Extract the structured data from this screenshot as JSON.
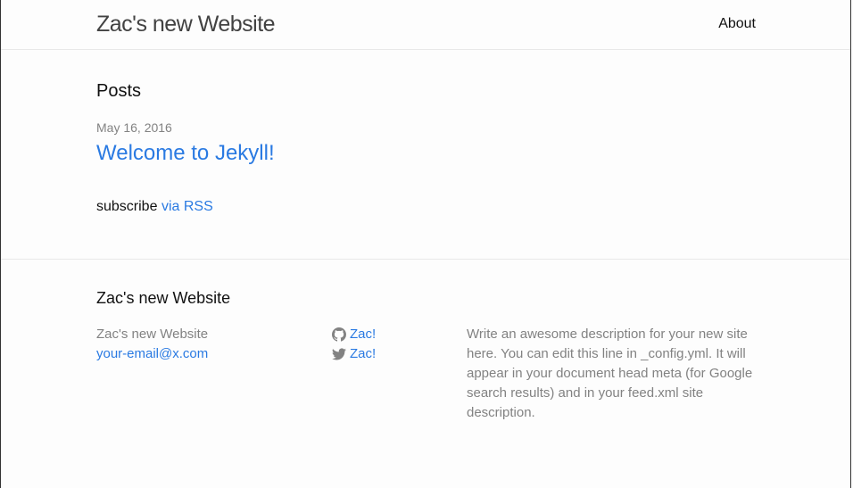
{
  "header": {
    "site_title": "Zac's new Website",
    "nav": [
      {
        "label": "About"
      }
    ]
  },
  "main": {
    "heading": "Posts",
    "posts": [
      {
        "date": "May 16, 2016",
        "title": "Welcome to Jekyll!"
      }
    ],
    "rss": {
      "prefix": "subscribe",
      "link_label": "via RSS"
    }
  },
  "footer": {
    "heading": "Zac's new Website",
    "contact": {
      "name": "Zac's new Website",
      "email": "your-email@x.com"
    },
    "social": [
      {
        "icon": "github-icon",
        "label": "Zac!"
      },
      {
        "icon": "twitter-icon",
        "label": "Zac!"
      }
    ],
    "description": "Write an awesome description for your new site here. You can edit this line in _config.yml. It will appear in your document head meta (for Google search results) and in your feed.xml site description."
  },
  "colors": {
    "link": "#2a7ae2",
    "muted": "#828282",
    "title": "#424242",
    "border": "#e8e8e8"
  }
}
